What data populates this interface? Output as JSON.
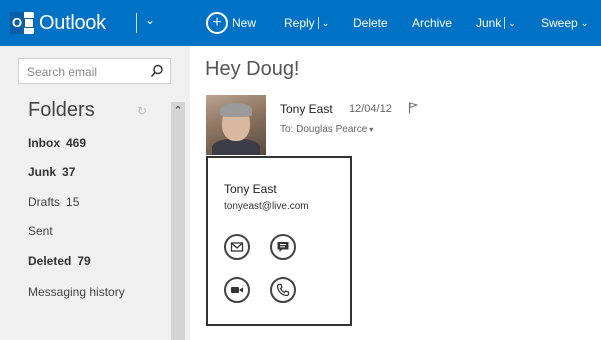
{
  "app": {
    "name": "Outlook"
  },
  "toolbar": {
    "new_label": "New",
    "reply_label": "Reply",
    "delete_label": "Delete",
    "archive_label": "Archive",
    "junk_label": "Junk",
    "sweep_label": "Sweep"
  },
  "search": {
    "placeholder": "Search email"
  },
  "sidebar": {
    "title": "Folders",
    "folders": [
      {
        "label": "Inbox",
        "count": "469",
        "bold": true
      },
      {
        "label": "Junk",
        "count": "37",
        "bold": true
      },
      {
        "label": "Drafts",
        "count": "15",
        "bold": false
      },
      {
        "label": "Sent",
        "count": "",
        "bold": false
      },
      {
        "label": "Deleted",
        "count": "79",
        "bold": true
      },
      {
        "label": "Messaging history",
        "count": "",
        "bold": false
      }
    ]
  },
  "message": {
    "subject": "Hey Doug!",
    "sender": "Tony East",
    "date": "12/04/12",
    "to": "To: Douglas Pearce"
  },
  "contact_card": {
    "name": "Tony East",
    "email": "tonyeast@live.com",
    "actions": [
      "email-icon",
      "chat-icon",
      "video-icon",
      "phone-icon"
    ]
  },
  "colors": {
    "accent": "#0072c6",
    "sidebar_bg": "#f0f0f0"
  }
}
